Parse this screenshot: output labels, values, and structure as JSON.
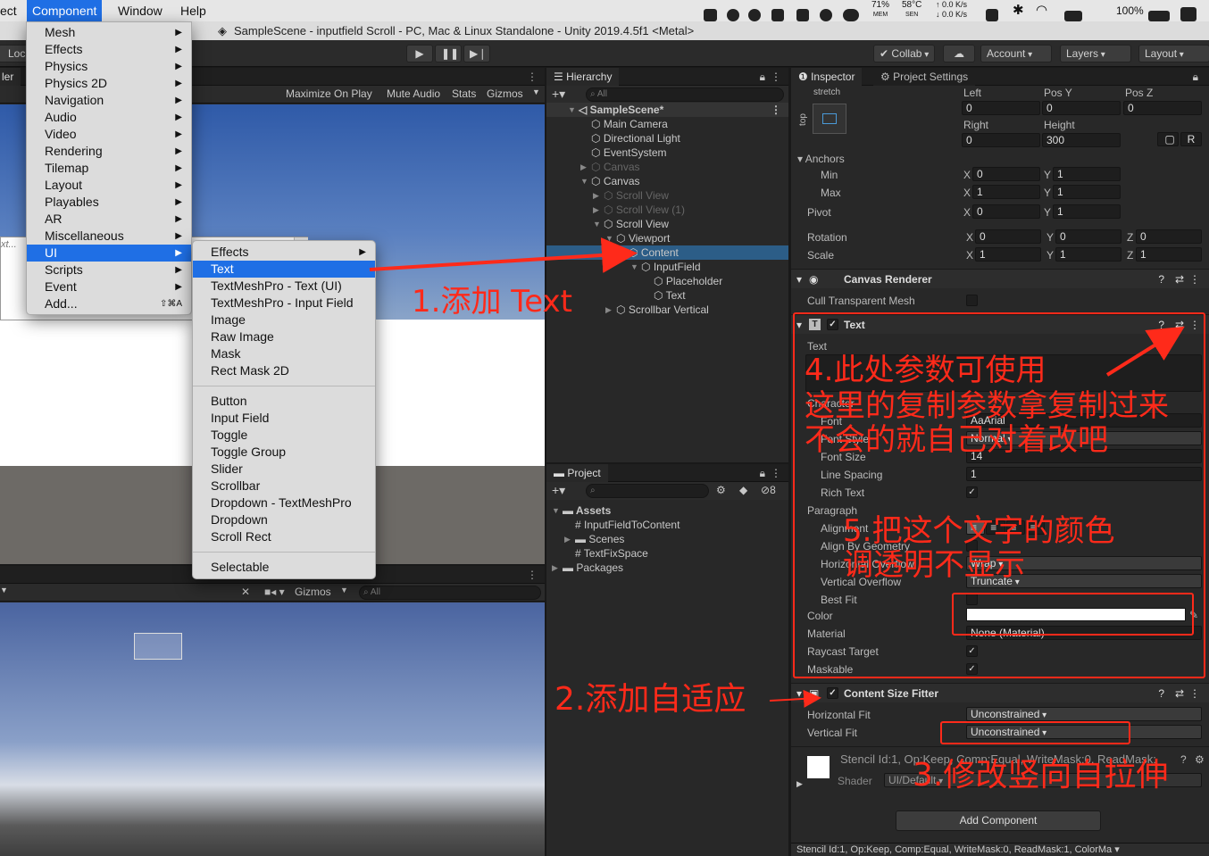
{
  "menubar": {
    "items": [
      "ect",
      "Component",
      "Window",
      "Help"
    ],
    "active": "Component",
    "cpu_percent": "71%",
    "cpu_label": "MEM",
    "temp": "58°C",
    "temp_label": "SEN",
    "net_up": "0.0 K/s",
    "net_down": "0.0 K/s",
    "battery": "100%"
  },
  "window_title": "SampleScene - inputfield Scroll - PC, Mac & Linux Standalone - Unity 2019.4.5f1 <Metal>",
  "toolbar": {
    "loc_label": "Loc",
    "collab": "Collab",
    "account": "Account",
    "layers": "Layers",
    "layout": "Layout"
  },
  "game_view": {
    "tab_label": "ler",
    "maximize": "Maximize On Play",
    "mute": "Mute Audio",
    "stats": "Stats",
    "gizmos": "Gizmos",
    "field_hint": "xt..."
  },
  "scene_view": {
    "gizmos": "Gizmos",
    "search_placeholder": "All"
  },
  "component_menu": [
    {
      "label": "Mesh",
      "arrow": true
    },
    {
      "label": "Effects",
      "arrow": true
    },
    {
      "label": "Physics",
      "arrow": true
    },
    {
      "label": "Physics 2D",
      "arrow": true
    },
    {
      "label": "Navigation",
      "arrow": true
    },
    {
      "label": "Audio",
      "arrow": true
    },
    {
      "label": "Video",
      "arrow": true
    },
    {
      "label": "Rendering",
      "arrow": true
    },
    {
      "label": "Tilemap",
      "arrow": true
    },
    {
      "label": "Layout",
      "arrow": true
    },
    {
      "label": "Playables",
      "arrow": true
    },
    {
      "label": "AR",
      "arrow": true
    },
    {
      "label": "Miscellaneous",
      "arrow": true
    },
    {
      "label": "UI",
      "arrow": true,
      "selected": true
    },
    {
      "label": "Scripts",
      "arrow": true
    },
    {
      "label": "Event",
      "arrow": true
    },
    {
      "label": "Add...",
      "shortcut": "⇧⌘A"
    }
  ],
  "ui_submenu": [
    {
      "label": "Effects",
      "arrow": true
    },
    {
      "label": "Text",
      "selected": true
    },
    {
      "label": "TextMeshPro - Text (UI)"
    },
    {
      "label": "TextMeshPro - Input Field"
    },
    {
      "label": "Image"
    },
    {
      "label": "Raw Image"
    },
    {
      "label": "Mask"
    },
    {
      "label": "Rect Mask 2D"
    },
    {
      "sep": true
    },
    {
      "label": "Button"
    },
    {
      "label": "Input Field"
    },
    {
      "label": "Toggle"
    },
    {
      "label": "Toggle Group"
    },
    {
      "label": "Slider"
    },
    {
      "label": "Scrollbar"
    },
    {
      "label": "Dropdown - TextMeshPro"
    },
    {
      "label": "Dropdown"
    },
    {
      "label": "Scroll Rect"
    },
    {
      "sep": true
    },
    {
      "label": "Selectable"
    }
  ],
  "hierarchy": {
    "tab": "Hierarchy",
    "search_placeholder": "All",
    "items": [
      {
        "label": "SampleScene*",
        "depth": 0,
        "bold": true,
        "expanded": true
      },
      {
        "label": "Main Camera",
        "depth": 1
      },
      {
        "label": "Directional Light",
        "depth": 1
      },
      {
        "label": "EventSystem",
        "depth": 1
      },
      {
        "label": "Canvas",
        "depth": 1,
        "dim": true,
        "collapsed": true
      },
      {
        "label": "Canvas",
        "depth": 1,
        "expanded": true
      },
      {
        "label": "Scroll View",
        "depth": 2,
        "dim": true,
        "collapsed": true
      },
      {
        "label": "Scroll View (1)",
        "depth": 2,
        "dim": true,
        "collapsed": true
      },
      {
        "label": "Scroll View",
        "depth": 2,
        "expanded": true
      },
      {
        "label": "Viewport",
        "depth": 3,
        "expanded": true
      },
      {
        "label": "Content",
        "depth": 4,
        "selected": true
      },
      {
        "label": "InputField",
        "depth": 5,
        "expanded": true
      },
      {
        "label": "Placeholder",
        "depth": 6
      },
      {
        "label": "Text",
        "depth": 6
      },
      {
        "label": "Scrollbar Vertical",
        "depth": 3,
        "collapsed": true
      }
    ]
  },
  "project": {
    "tab": "Project",
    "hidden_count": "8",
    "items": [
      {
        "label": "Assets",
        "depth": 0,
        "expanded": true,
        "folder": true
      },
      {
        "label": "InputFieldToContent",
        "depth": 1,
        "script": true
      },
      {
        "label": "Scenes",
        "depth": 1,
        "folder": true,
        "collapsed": true
      },
      {
        "label": "TextFixSpace",
        "depth": 1,
        "script": true
      },
      {
        "label": "Packages",
        "depth": 0,
        "folder": true,
        "collapsed": true
      }
    ]
  },
  "inspector": {
    "tab": "Inspector",
    "tab2": "Project Settings",
    "anchor_preset_h": "stretch",
    "anchor_preset_v": "top",
    "rect": {
      "left_label": "Left",
      "left": "0",
      "posy_label": "Pos Y",
      "posy": "0",
      "posz_label": "Pos Z",
      "posz": "0",
      "right_label": "Right",
      "right": "0",
      "height_label": "Height",
      "height": "300",
      "r_btn": "R"
    },
    "anchors_label": "Anchors",
    "min_label": "Min",
    "min_x": "0",
    "min_y": "1",
    "max_label": "Max",
    "max_x": "1",
    "max_y": "1",
    "pivot_label": "Pivot",
    "pivot_x": "0",
    "pivot_y": "1",
    "rotation_label": "Rotation",
    "rot_x": "0",
    "rot_y": "0",
    "rot_z": "0",
    "scale_label": "Scale",
    "scale_x": "1",
    "scale_y": "1",
    "scale_z": "1",
    "canvas_renderer": "Canvas Renderer",
    "cull_label": "Cull Transparent Mesh",
    "text_comp": "Text",
    "text_label": "Text",
    "character_label": "Character",
    "font_label": "Font",
    "font_value": "Arial",
    "font_style_label": "Font Style",
    "font_style_value": "Normal",
    "font_size_label": "Font Size",
    "font_size_value": "14",
    "line_spacing_label": "Line Spacing",
    "line_spacing_value": "1",
    "rich_text_label": "Rich Text",
    "paragraph_label": "Paragraph",
    "alignment_label": "Alignment",
    "align_geo_label": "Align By Geometry",
    "horiz_label": "Horizontal Overflow",
    "horiz_value": "Wrap",
    "vert_label": "Vertical Overflow",
    "vert_value": "Truncate",
    "best_fit_label": "Best Fit",
    "color_label": "Color",
    "color_value": "#ffffff",
    "material_label": "Material",
    "material_value": "None (Material)",
    "raycast_label": "Raycast Target",
    "maskable_label": "Maskable",
    "csf": "Content Size Fitter",
    "hfit_label": "Horizontal Fit",
    "hfit_value": "Unconstrained",
    "vfit_label": "Vertical Fit",
    "vfit_value": "Unconstrained",
    "stencil_info": "Stencil Id:1, Op:Keep, Comp:Equal, WriteMask:0, ReadMask:",
    "shader_label": "Shader",
    "shader_value": "UI/Default",
    "add_component": "Add Component",
    "footer": "Stencil Id:1, Op:Keep, Comp:Equal, WriteMask:0, ReadMask:1, ColorMa"
  },
  "annotations": {
    "a1": "1.添加 Text",
    "a2": "2.添加自适应",
    "a3": "3.修改竖向自拉伸",
    "a4_l1": "4.此处参数可使用",
    "a4_l2": "这里的复制参数拿复制过来",
    "a4_l3": "不会的就自己对着改吧",
    "a5_l1": "5.把这个文字的颜色",
    "a5_l2": "调透明不显示"
  },
  "colors": {
    "accent": "#1f6fe5",
    "annotation": "#ff2a1a",
    "selection": "#2c5d87"
  }
}
